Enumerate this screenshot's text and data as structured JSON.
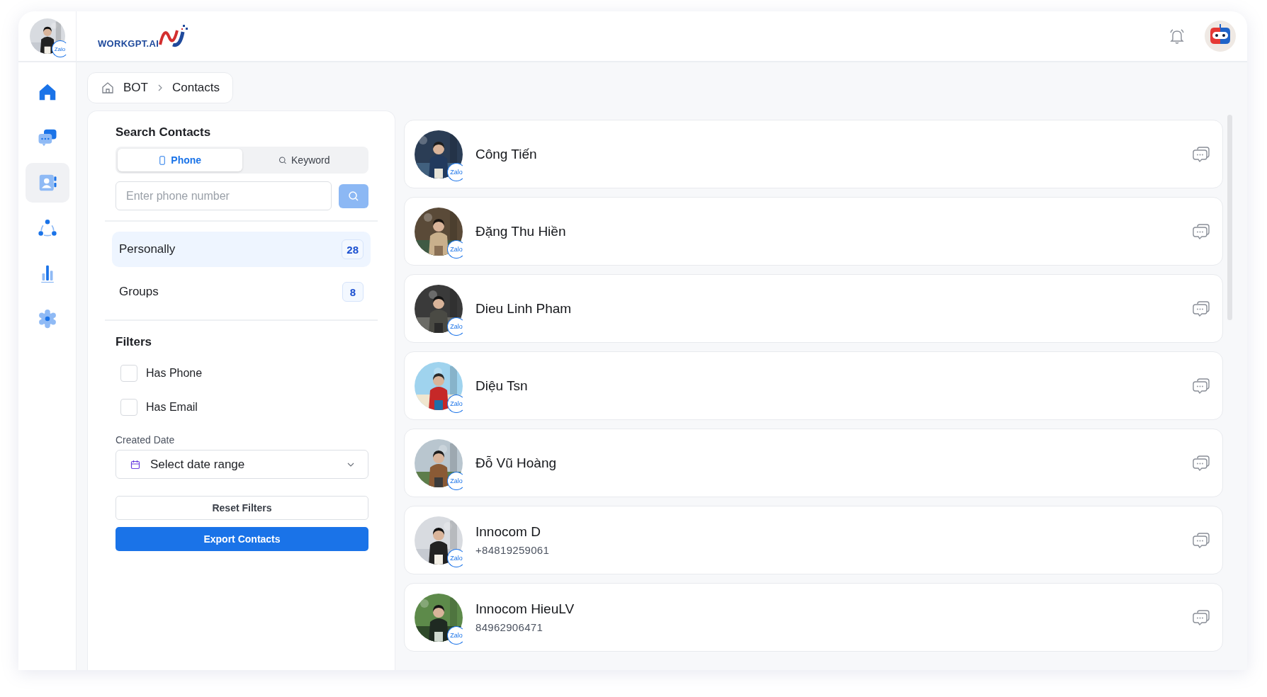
{
  "user": {
    "badge": "Zalo"
  },
  "logo": {
    "text": "WORKGPT.AI"
  },
  "nav": [
    {
      "kind": "home",
      "selected": false
    },
    {
      "kind": "chat",
      "selected": false
    },
    {
      "kind": "contacts",
      "selected": true
    },
    {
      "kind": "network",
      "selected": false
    },
    {
      "kind": "chart",
      "selected": false
    },
    {
      "kind": "gear",
      "selected": false
    }
  ],
  "breadcrumb": [
    "BOT",
    "Contacts"
  ],
  "search": {
    "title": "Search Contacts",
    "placeholder": "Enter phone number",
    "tabs": [
      {
        "label": "Phone",
        "kind": "phone",
        "selected": true
      },
      {
        "label": "Keyword",
        "kind": "keyword",
        "selected": false
      }
    ]
  },
  "categories": [
    {
      "label": "Personally",
      "count": "28",
      "selected": true
    },
    {
      "label": "Groups",
      "count": "8",
      "selected": false
    }
  ],
  "filters": {
    "title": "Filters",
    "options": [
      {
        "label": "Has Phone",
        "checked": false
      },
      {
        "label": "Has Email",
        "checked": false
      }
    ],
    "date_label": "Created Date",
    "date_placeholder": "Select date range",
    "reset": "Reset Filters",
    "export": "Export Contacts"
  },
  "contacts": [
    {
      "name": "Công Tiến",
      "badge": "Zalo"
    },
    {
      "name": "Đặng Thu Hiền",
      "badge": "Zalo"
    },
    {
      "name": "Dieu Linh Pham",
      "badge": "Zalo"
    },
    {
      "name": "Diệu Tsn",
      "badge": "Zalo"
    },
    {
      "name": "Đỗ Vũ Hoàng",
      "badge": "Zalo"
    },
    {
      "name": "Innocom D",
      "phone": "+84819259061",
      "badge": "Zalo"
    },
    {
      "name": "Innocom HieuLV",
      "phone": "84962906471",
      "badge": "Zalo"
    }
  ]
}
